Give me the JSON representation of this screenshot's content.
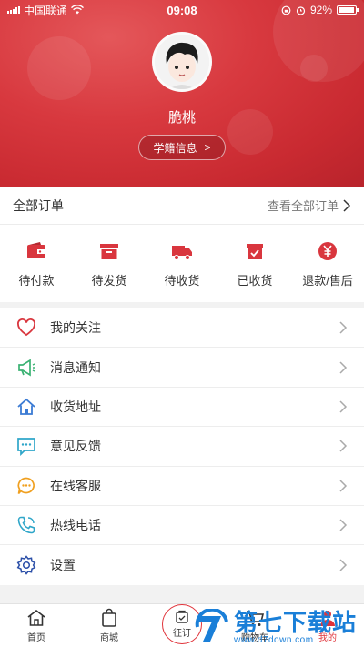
{
  "status_bar": {
    "carrier": "中国联通",
    "time": "09:08",
    "battery": "92%",
    "battery_level": 0.92
  },
  "profile": {
    "name": "脆桃",
    "student_info_button": "学籍信息",
    "student_info_arrow": ">"
  },
  "orders": {
    "title": "全部订单",
    "view_all": "查看全部订单",
    "items": [
      {
        "label": "待付款",
        "icon": "wallet-icon"
      },
      {
        "label": "待发货",
        "icon": "box-icon"
      },
      {
        "label": "待收货",
        "icon": "truck-icon"
      },
      {
        "label": "已收货",
        "icon": "received-box-icon"
      },
      {
        "label": "退款/售后",
        "icon": "yen-icon"
      }
    ]
  },
  "menu": [
    {
      "label": "我的关注",
      "icon": "heart-icon"
    },
    {
      "label": "消息通知",
      "icon": "megaphone-icon"
    },
    {
      "label": "收货地址",
      "icon": "house-icon"
    },
    {
      "label": "意见反馈",
      "icon": "chat-icon"
    },
    {
      "label": "在线客服",
      "icon": "chat-bubble-icon"
    },
    {
      "label": "热线电话",
      "icon": "phone-icon"
    },
    {
      "label": "设置",
      "icon": "gear-icon"
    }
  ],
  "tabbar": {
    "items": [
      {
        "label": "首页",
        "icon": "home-icon"
      },
      {
        "label": "商城",
        "icon": "bag-icon"
      },
      {
        "label": "征订",
        "icon": "subscribe-icon"
      },
      {
        "label": "购物车",
        "icon": "cart-icon"
      },
      {
        "label": "我的",
        "icon": "user-icon"
      }
    ]
  },
  "watermark": {
    "title": "第七下载站",
    "url": "www.d7down.com"
  },
  "colors": {
    "accent": "#e0333a",
    "header": "#d8393f",
    "menu_icon_red": "#d9363e",
    "menu_icon_green": "#3bb273",
    "menu_icon_blue": "#3b7bd4",
    "menu_icon_teal": "#2fa6c9",
    "menu_icon_orange": "#f0a020",
    "menu_icon_navy": "#2b4fa8"
  }
}
